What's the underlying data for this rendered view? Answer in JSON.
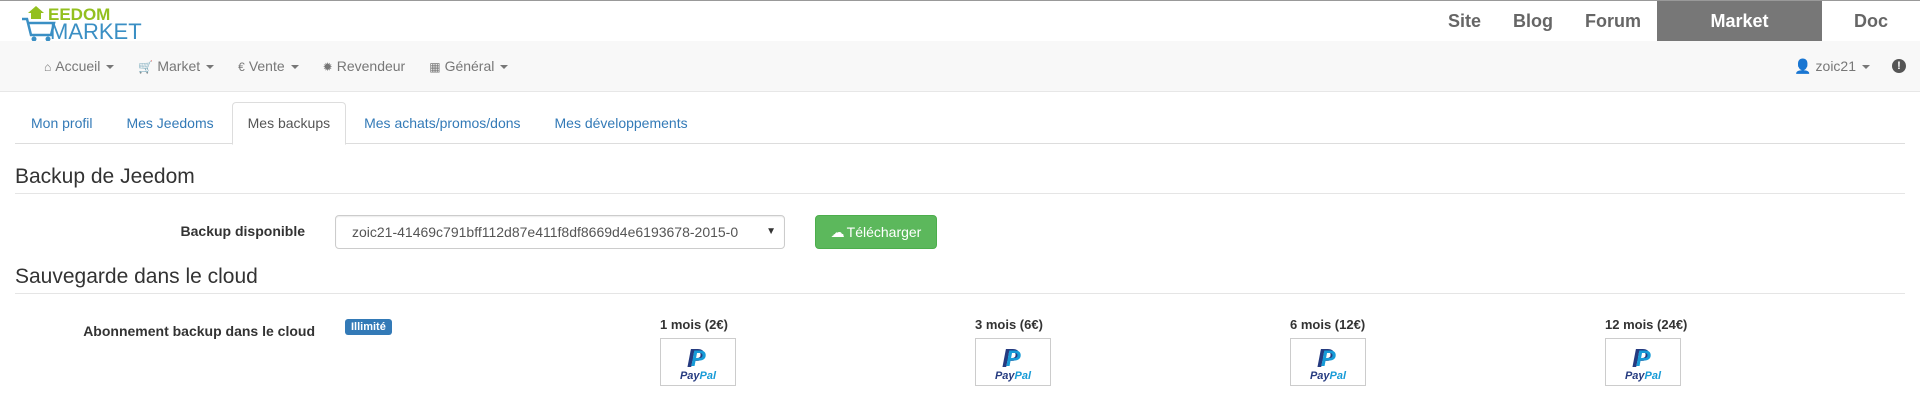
{
  "logo": {
    "line1": "EEDOM",
    "line2": "MARKET"
  },
  "site_nav": [
    {
      "label": "Site"
    },
    {
      "label": "Blog"
    },
    {
      "label": "Forum"
    },
    {
      "label": "Market",
      "active": true
    },
    {
      "label": "Doc"
    }
  ],
  "navbar": {
    "items": [
      {
        "icon": "home-icon",
        "label": "Accueil"
      },
      {
        "icon": "cart-icon",
        "label": "Market"
      },
      {
        "icon": "euro-icon",
        "label": "Vente"
      },
      {
        "icon": "gear-icon",
        "label": "Revendeur"
      },
      {
        "icon": "grid-icon",
        "label": "Général"
      }
    ],
    "user": "zoic21"
  },
  "tabs": [
    {
      "label": "Mon profil"
    },
    {
      "label": "Mes Jeedoms"
    },
    {
      "label": "Mes backups",
      "active": true
    },
    {
      "label": "Mes achats/promos/dons"
    },
    {
      "label": "Mes développements"
    }
  ],
  "backup": {
    "title": "Backup de Jeedom",
    "label": "Backup disponible",
    "selected": "zoic21-41469c791bff112d87e411f8df8669d4e6193678-2015-0",
    "download_label": "Télécharger"
  },
  "cloud": {
    "title": "Sauvegarde dans le cloud",
    "label": "Abonnement backup dans le cloud",
    "badge": "Illimité",
    "plans": [
      {
        "label": "1 mois (2€)"
      },
      {
        "label": "3 mois (6€)"
      },
      {
        "label": "6 mois (12€)"
      },
      {
        "label": "12 mois (24€)"
      }
    ],
    "paypal_pay": "Pay",
    "paypal_pal": "Pal"
  },
  "colors": {
    "accent": "#337ab7",
    "success": "#5cb85c",
    "active_nav": "#777777"
  }
}
